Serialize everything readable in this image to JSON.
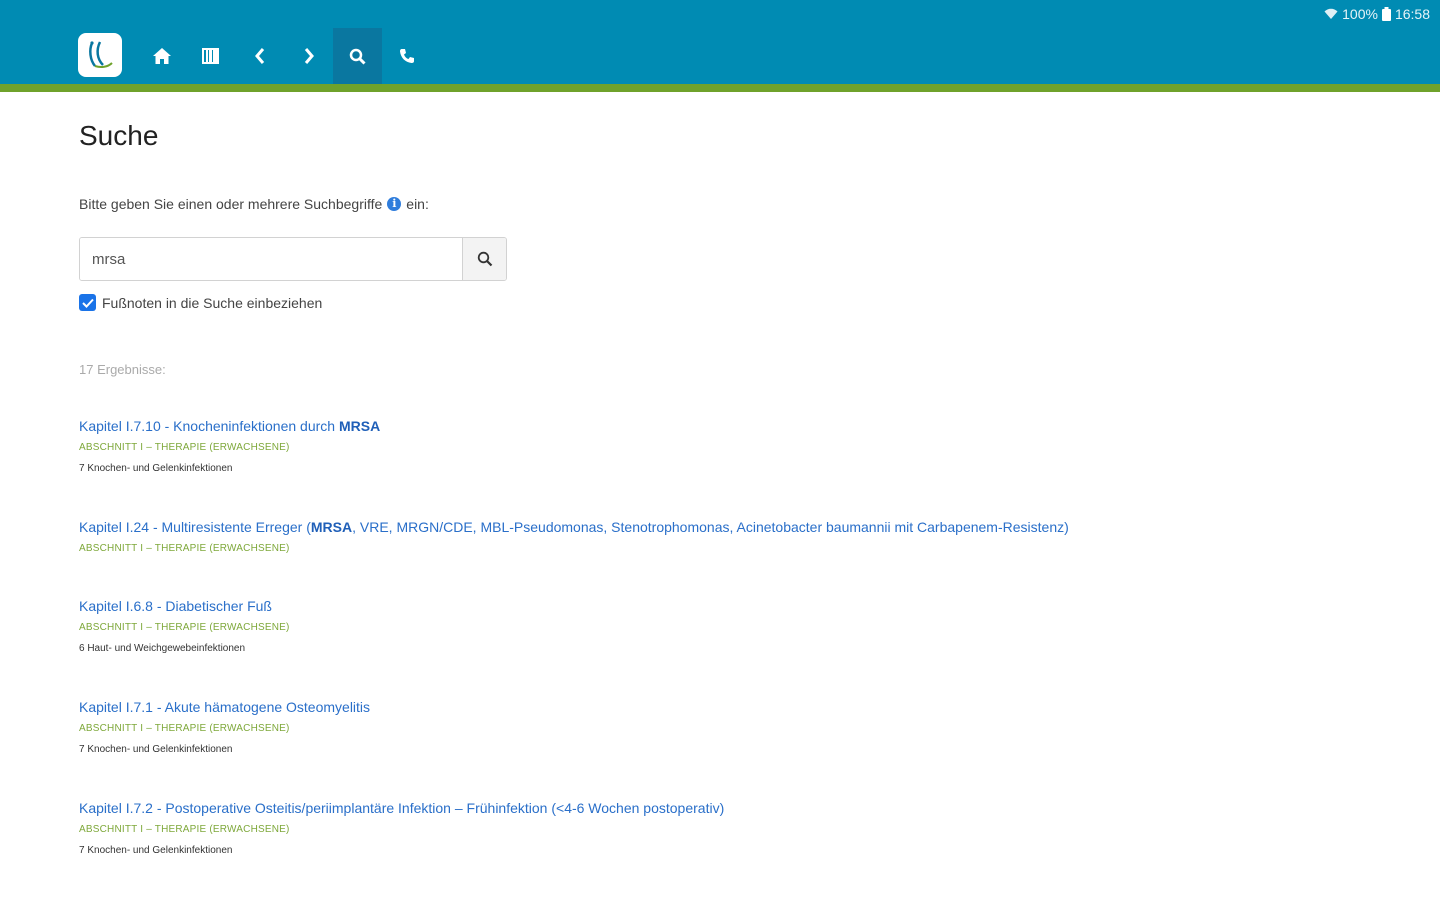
{
  "status_bar": {
    "battery": "100%",
    "time": "16:58"
  },
  "nav": {
    "items": [
      {
        "name": "home-icon"
      },
      {
        "name": "book-icon"
      },
      {
        "name": "chevron-left-icon"
      },
      {
        "name": "chevron-right-icon"
      },
      {
        "name": "search-icon",
        "active": true
      },
      {
        "name": "phone-icon"
      }
    ]
  },
  "colors": {
    "header": "#008bb3",
    "accent_line": "#6fa22b",
    "link": "#2a6fc9",
    "section": "#7ea83a"
  },
  "page": {
    "title": "Suche",
    "instructions_before": "Bitte geben Sie einen oder mehrere Suchbegriffe",
    "instructions_after": "ein:",
    "search": {
      "value": "mrsa",
      "placeholder": ""
    },
    "footnote_label": "Fußnoten in die Suche einbeziehen",
    "footnote_checked": true,
    "result_count": "17 Ergebnisse:"
  },
  "results": [
    {
      "title_pre": "Kapitel I.7.10 - Knocheninfektionen durch ",
      "highlight": "MRSA",
      "title_post": "",
      "section": "ABSCHNITT I – THERAPIE (ERWACHSENE)",
      "sub": "7 Knochen- und Gelenkinfektionen"
    },
    {
      "title_pre": "Kapitel I.24 - Multiresistente Erreger (",
      "highlight": "MRSA",
      "title_post": ", VRE, MRGN/CDE, MBL-Pseudomonas, Stenotrophomonas, Acinetobacter baumannii mit Carbapenem-Resistenz)",
      "section": "ABSCHNITT I – THERAPIE (ERWACHSENE)",
      "sub": ""
    },
    {
      "title_pre": "Kapitel I.6.8 - Diabetischer Fuß",
      "highlight": "",
      "title_post": "",
      "section": "ABSCHNITT I – THERAPIE (ERWACHSENE)",
      "sub": "6 Haut- und Weichgewebeinfektionen"
    },
    {
      "title_pre": "Kapitel I.7.1 - Akute hämatogene Osteomyelitis",
      "highlight": "",
      "title_post": "",
      "section": "ABSCHNITT I – THERAPIE (ERWACHSENE)",
      "sub": "7 Knochen- und Gelenkinfektionen"
    },
    {
      "title_pre": "Kapitel I.7.2 - Postoperative Osteitis/periimplantäre Infektion – Frühinfektion (<4-6 Wochen postoperativ)",
      "highlight": "",
      "title_post": "",
      "section": "ABSCHNITT I – THERAPIE (ERWACHSENE)",
      "sub": "7 Knochen- und Gelenkinfektionen"
    }
  ]
}
